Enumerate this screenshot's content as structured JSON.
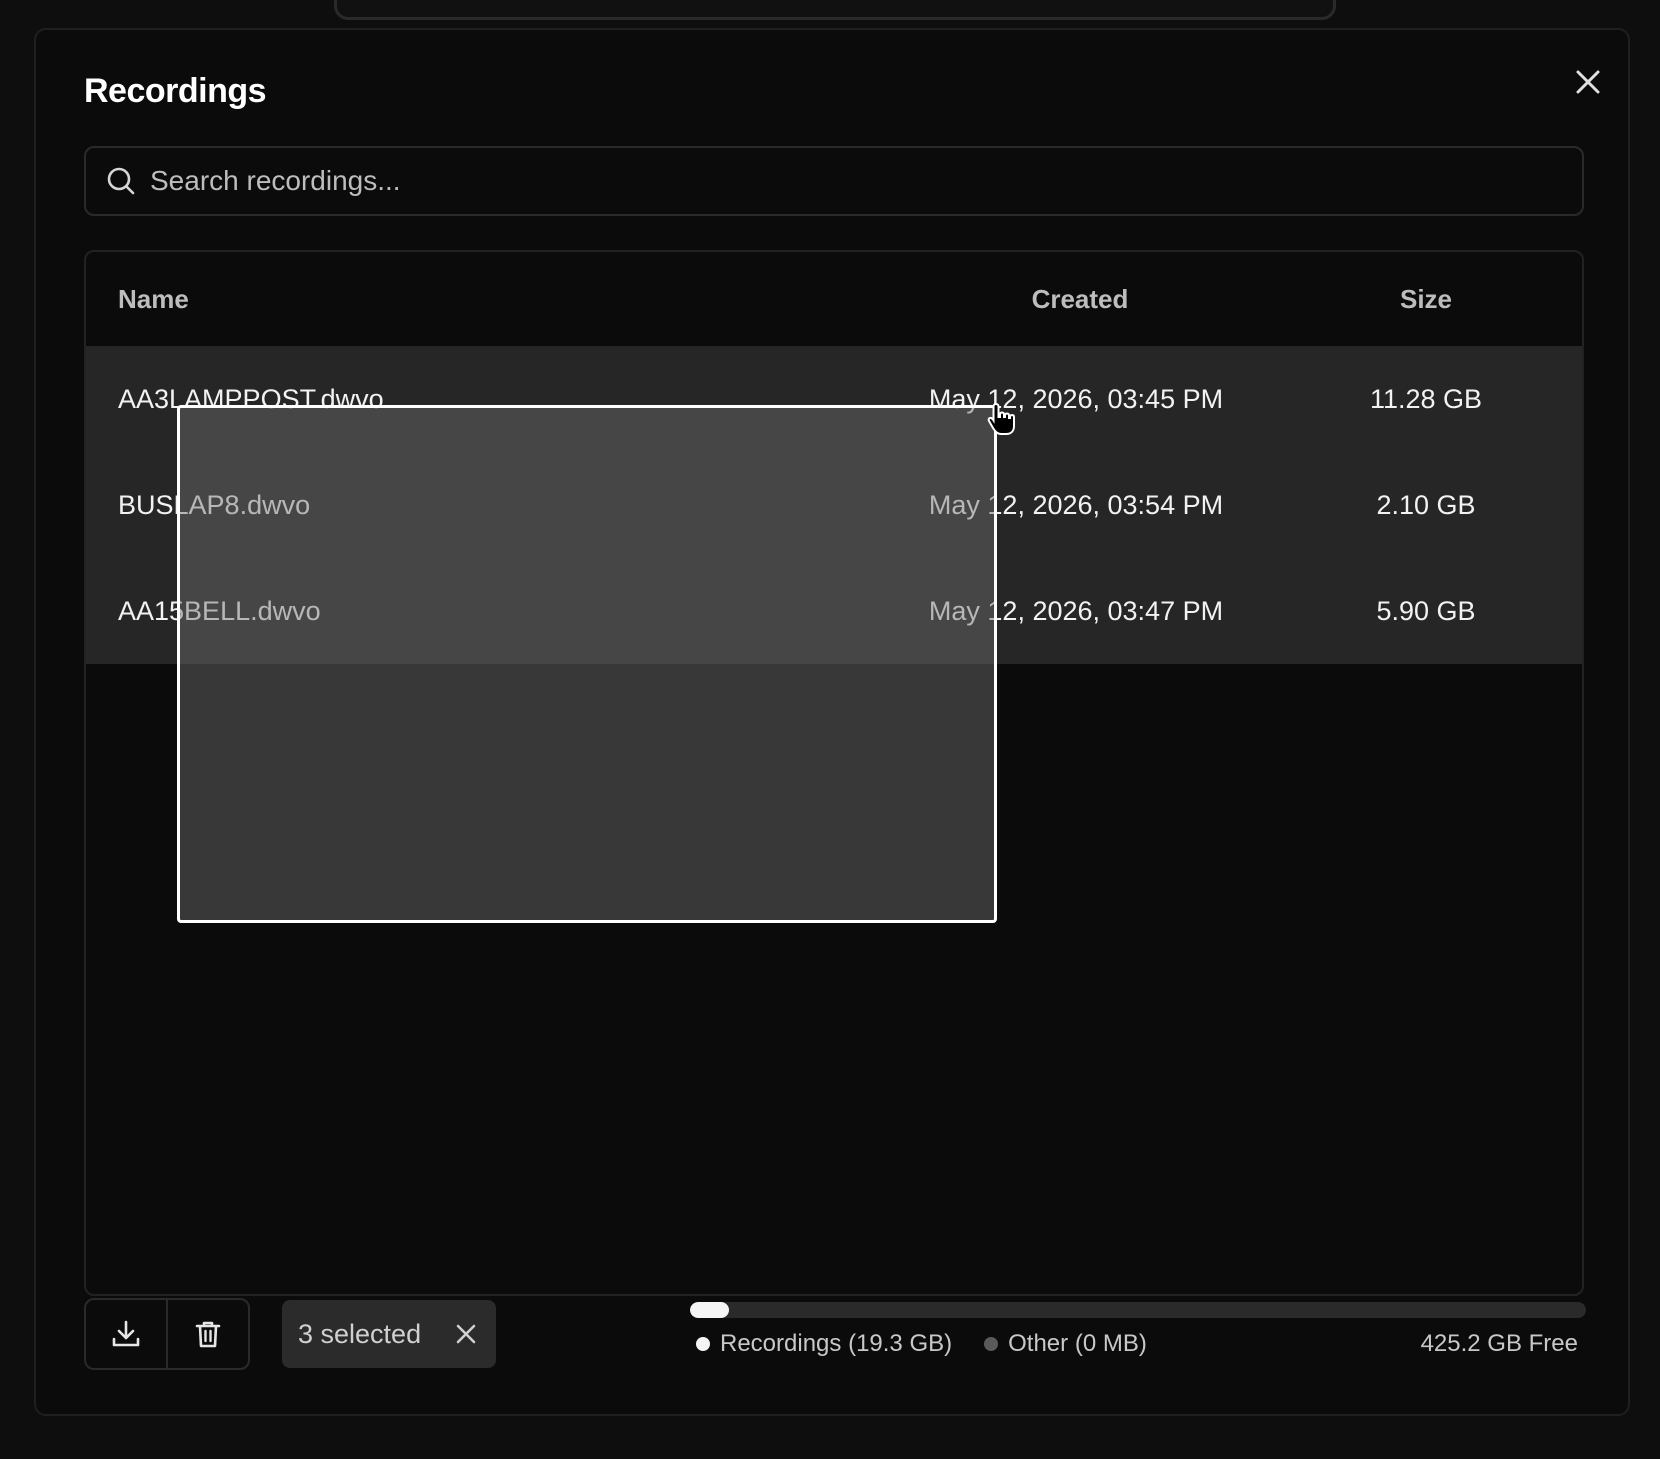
{
  "dialog": {
    "title": "Recordings",
    "close_icon": "close-icon"
  },
  "search": {
    "placeholder": "Search recordings...",
    "value": ""
  },
  "table": {
    "headers": {
      "name": "Name",
      "created": "Created",
      "size": "Size"
    },
    "rows": [
      {
        "name": "AA3LAMPPOST.dwvo",
        "created": "May 12, 2026, 03:45 PM",
        "size": "11.28 GB",
        "selected": true
      },
      {
        "name": "BUSLAP8.dwvo",
        "created": "May 12, 2026, 03:54 PM",
        "size": "2.10 GB",
        "selected": true
      },
      {
        "name": "AA15BELL.dwvo",
        "created": "May 12, 2026, 03:47 PM",
        "size": "5.90 GB",
        "selected": true
      }
    ]
  },
  "footer": {
    "download_icon": "download-icon",
    "delete_icon": "trash-icon",
    "selected_label": "3 selected",
    "clear_icon": "close-icon"
  },
  "storage": {
    "used_fraction": 0.043,
    "legend": {
      "recordings_label": "Recordings",
      "recordings_value": "(19.3 GB)",
      "other_label": "Other",
      "other_value": "(0 MB)"
    },
    "free_label": "425.2 GB Free",
    "colors": {
      "recordings": "#f5f5f5",
      "other": "#5a5a5a",
      "bar_bg": "#2a2a2a"
    }
  }
}
